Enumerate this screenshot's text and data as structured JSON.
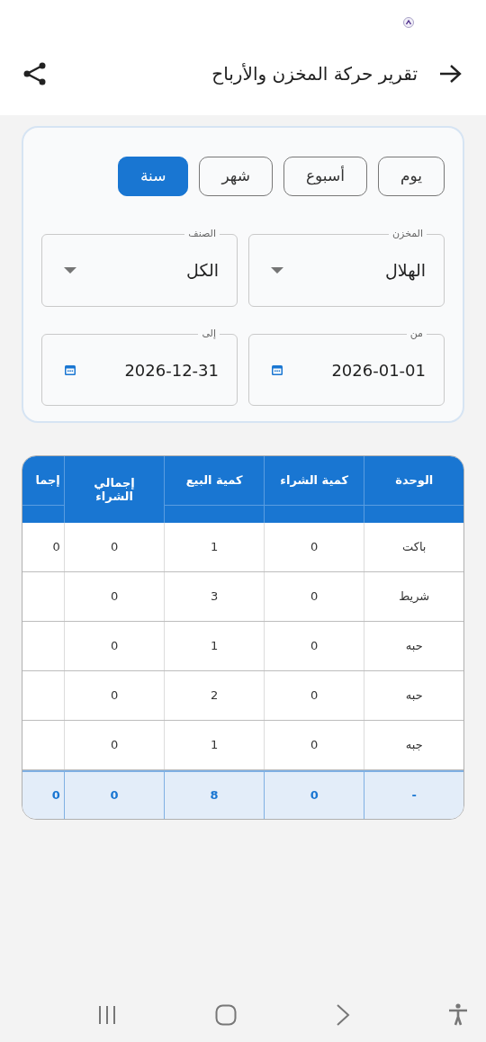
{
  "app_bar": {
    "title": "تقرير حركة المخزن والأرباح"
  },
  "period_tabs": [
    {
      "label": "يوم",
      "selected": false
    },
    {
      "label": "أسبوع",
      "selected": false
    },
    {
      "label": "شهر",
      "selected": false
    },
    {
      "label": "سنة",
      "selected": true
    }
  ],
  "filters": [
    {
      "kind": "select",
      "label": "المخزن",
      "value": "الهلال"
    },
    {
      "kind": "select",
      "label": "الصنف",
      "value": "الكل"
    },
    {
      "kind": "date",
      "label": "من",
      "value": "2026-01-01"
    },
    {
      "kind": "date",
      "label": "إلى",
      "value": "2026-12-31"
    }
  ],
  "table": {
    "columns": [
      "الوحدة",
      "كمية الشراء",
      "كمية البيع",
      "إجمالي الشراء",
      "إجما"
    ],
    "rows": [
      [
        "باكت",
        "0",
        "1",
        "0",
        "0"
      ],
      [
        "شريط",
        "0",
        "3",
        "0",
        ""
      ],
      [
        "حبه",
        "0",
        "1",
        "0",
        ""
      ],
      [
        "حبه",
        "0",
        "2",
        "0",
        ""
      ],
      [
        "جبه",
        "0",
        "1",
        "0",
        ""
      ]
    ],
    "total": [
      "-",
      "0",
      "8",
      "0",
      "0"
    ]
  }
}
